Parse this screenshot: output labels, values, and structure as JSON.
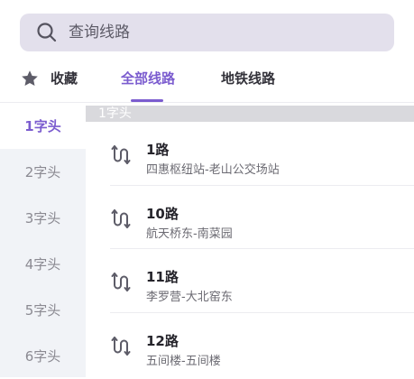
{
  "search": {
    "placeholder": "查询线路"
  },
  "tabs": [
    {
      "label": "收藏",
      "icon": "star-icon"
    },
    {
      "label": "全部线路",
      "active": true
    },
    {
      "label": "地铁线路"
    }
  ],
  "side_nav": [
    {
      "label": "1字头",
      "active": true
    },
    {
      "label": "2字头"
    },
    {
      "label": "3字头"
    },
    {
      "label": "4字头"
    },
    {
      "label": "5字头"
    },
    {
      "label": "6字头"
    }
  ],
  "group_header": "1字头",
  "routes": [
    {
      "name": "1路",
      "stops": "四惠枢纽站-老山公交场站"
    },
    {
      "name": "10路",
      "stops": "航天桥东-南菜园"
    },
    {
      "name": "11路",
      "stops": "李罗营-大北窑东"
    },
    {
      "name": "12路",
      "stops": "五间楼-五间楼"
    }
  ],
  "colors": {
    "accent": "#7b5ccf",
    "search_bg": "#e3e0ec",
    "sidebar_bg": "#f1f3f7"
  }
}
